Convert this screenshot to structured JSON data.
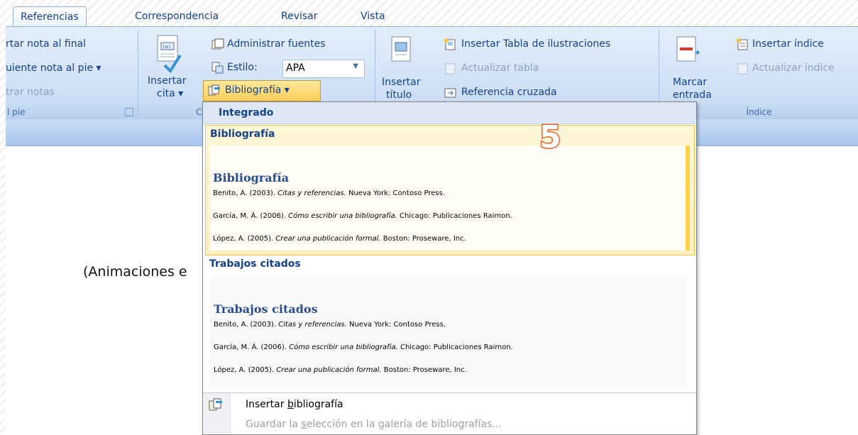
{
  "tabs": [
    {
      "label": "Referencias",
      "active": true
    },
    {
      "label": "Correspondencia",
      "active": false
    },
    {
      "label": "Revisar",
      "active": false
    },
    {
      "label": "Vista",
      "active": false
    }
  ],
  "footnotes_group": {
    "insert_endnote": "rtar nota al final",
    "next_footnote": "uiente nota al pie ▾",
    "show_notes": "trar notas",
    "label": "l pie"
  },
  "citations_group": {
    "insert_citation": "Insertar",
    "insert_citation_2": "cita ▾",
    "manage_sources": "Administrar fuentes",
    "style_label": "Estilo:",
    "style_value": "APA",
    "bibliography_button": "Bibliografía ▾",
    "label": "C"
  },
  "captions_group": {
    "insert_caption": "Insertar",
    "insert_caption_2": "título",
    "insert_table_figures": "Insertar Tabla de ilustraciones",
    "update_table": "Actualizar tabla",
    "cross_reference": "Referencia cruzada"
  },
  "index_group": {
    "mark_entry": "Marcar",
    "mark_entry_2": "entrada",
    "insert_index": "Insertar índice",
    "update_index": "Actualizar índice",
    "label": "Índice"
  },
  "document": {
    "partial_text": "(Animaciones e"
  },
  "overlay_number": "5",
  "dropdown": {
    "header": "Integrado",
    "gallery1": {
      "label": "Bibliografía",
      "sample_title": "Bibliografía",
      "entries": [
        {
          "author": "Benito, A. (2003). ",
          "title": "Citas y referencias.",
          "rest": " Nueva York: Contoso Press."
        },
        {
          "author": "García, M. Á. (2006). ",
          "title": "Cómo escribir una bibliografía.",
          "rest": " Chicago: Publicaciones Raimon."
        },
        {
          "author": "López, A. (2005). ",
          "title": "Crear una publicación formal.",
          "rest": " Boston: Proseware, Inc."
        }
      ]
    },
    "gallery2": {
      "label": "Trabajos citados",
      "sample_title": "Trabajos citados",
      "entries": [
        {
          "author": "Benito, A. (2003). ",
          "title": "Citas y referencias.",
          "rest": " Nueva York: Contoso Press."
        },
        {
          "author": "García, M. Á. (2006). ",
          "title": "Cómo escribir una bibliografía.",
          "rest": " Chicago: Publicaciones Raimon."
        },
        {
          "author": "López, A. (2005). ",
          "title": "Crear una publicación formal.",
          "rest": " Boston: Proseware, Inc."
        }
      ]
    },
    "insert_bibliography_pre": "Insertar ",
    "insert_bibliography_key": "b",
    "insert_bibliography_post": "ibliografía",
    "save_selection_pre": "Guardar la ",
    "save_selection_key": "s",
    "save_selection_post": "elección en la galería de bibliografías..."
  },
  "colors": {
    "accent": "#15428b",
    "highlight": "#ffd24d",
    "overlay_number": "#e8642c"
  }
}
